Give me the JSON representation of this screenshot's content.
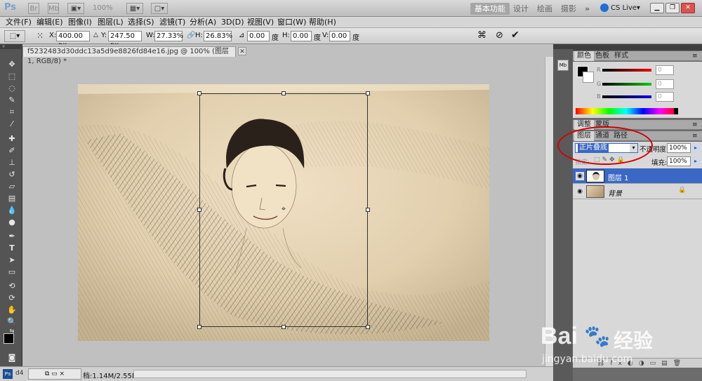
{
  "app": {
    "logo": "Ps",
    "zoom_display": "100%",
    "workspaces": [
      "基本功能",
      "设计",
      "绘画",
      "摄影"
    ],
    "more": "»",
    "cs_live": "CS Live▾"
  },
  "menu": [
    "文件(F)",
    "编辑(E)",
    "图像(I)",
    "图层(L)",
    "选择(S)",
    "滤镜(T)",
    "分析(A)",
    "3D(D)",
    "视图(V)",
    "窗口(W)",
    "帮助(H)"
  ],
  "options": {
    "x_label": "X:",
    "x_value": "400.00 px",
    "y_label": "Y:",
    "y_value": "247.50 px",
    "w_label": "W:",
    "w_value": "27.33%",
    "h_label": "H:",
    "h_value": "26.83%",
    "angle_value": "0.00",
    "deg1": "度",
    "hskew_label": "H:",
    "hskew_value": "0.00",
    "deg2": "度",
    "vskew_label": "V:",
    "vskew_value": "0.00",
    "deg3": "度"
  },
  "document": {
    "tab_title": "f5232483d30ddc13a5d9e8826fd84e16.jpg @ 100% (图层 1, RGB/8) *",
    "status": "档:1.14M/2.55M"
  },
  "panels": {
    "color_tabs": [
      "颜色",
      "色板",
      "样式"
    ],
    "adjust_tabs": [
      "调整",
      "蒙版"
    ],
    "layer_tabs": [
      "图层",
      "通道",
      "路径"
    ],
    "blend_mode": "正片叠底",
    "opacity_label": "不透明度:",
    "opacity_value": "100%",
    "lock_label": "锁定:",
    "fill_label": "填充:",
    "fill_value": "100%",
    "r_label": "R",
    "g_label": "G",
    "b_label": "B",
    "r_value": "0",
    "g_value": "0",
    "b_value": "0",
    "layers": [
      {
        "name": "图层 1",
        "selected": true
      },
      {
        "name": "背景",
        "selected": false,
        "locked": true
      }
    ]
  },
  "watermark": {
    "brand": "Bai",
    "brand2": "经验",
    "url": "jingyan.baidu.com"
  },
  "colors": {
    "accent_selected": "#3a68c4",
    "red_highlight": "#d40000"
  }
}
